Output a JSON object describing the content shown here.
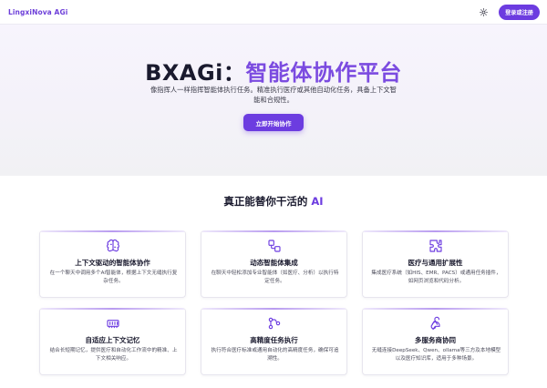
{
  "nav": {
    "brand": "LingxiNova AGi",
    "theme_icon": "sun-icon",
    "login_label": "登录或注册"
  },
  "hero": {
    "title_prefix": "BXAGi：",
    "title_accent": "智能体协作平台",
    "description": "像指挥人一样指挥智能体执行任务。精准执行医疗或其他自动化任务，具备上下文智能和合规性。",
    "cta_label": "立即开始协作"
  },
  "features": {
    "heading_prefix": "真正能替你干活的 ",
    "heading_accent": "AI",
    "items": [
      {
        "icon": "brain-icon",
        "title": "上下文驱动的智能体协作",
        "desc": "在一个聊天中调用多个AI智能体，根据上下文无缝执行复杂任务。"
      },
      {
        "icon": "layers-icon",
        "title": "动态智能体集成",
        "desc": "在聊天中轻松添加专业智能体（如医疗、分析）以执行特定任务。"
      },
      {
        "icon": "puzzle-icon",
        "title": "医疗与通用扩展性",
        "desc": "集成医疗系统（如HIS、EMR、PACS）或通用任务插件，如网页浏览和代码分析。"
      },
      {
        "icon": "memory-icon",
        "title": "自适应上下文记忆",
        "desc": "结合长短期记忆，提供医疗和自动化工作流中的精准、上下文相关响应。"
      },
      {
        "icon": "workflow-icon",
        "title": "高精度任务执行",
        "desc": "执行符合医疗标准或通用自动化的高精度任务，确保可追溯性。"
      },
      {
        "icon": "webhook-icon",
        "title": "多服务商协同",
        "desc": "无缝连接DeepSeek、Qwen、ollama等三方及本地模型以及医疗知识库，适用于多种场景。"
      }
    ]
  },
  "colors": {
    "accent": "#6c3ce0",
    "title_accent": "#7b4be0",
    "hero_bg": "#f4f2f9",
    "card_border": "#e7e5ee"
  }
}
